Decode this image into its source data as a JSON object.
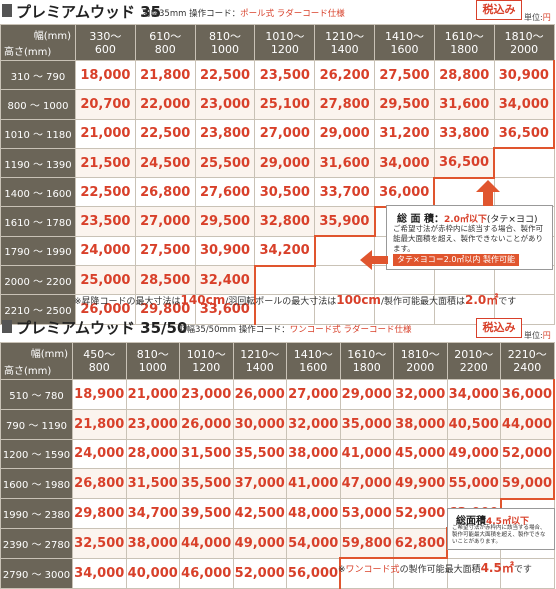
{
  "colors": {
    "accent": "#d8402a",
    "header_bg": "#6b6558",
    "outline": "#e0552e"
  },
  "table1": {
    "title": "プレミアムウッド 35",
    "spec_a": "羽幅35mm 操作コード：",
    "spec_b": "ポール式 ラダーコード仕様",
    "tax": "税込み",
    "unit_a": "単位:",
    "unit_b": "円",
    "corner_w": "幅(mm)",
    "corner_h": "高さ(mm)",
    "columns": [
      [
        "330～",
        "600"
      ],
      [
        "610～",
        "800"
      ],
      [
        "810～",
        "1000"
      ],
      [
        "1010～",
        "1200"
      ],
      [
        "1210～",
        "1400"
      ],
      [
        "1410～",
        "1600"
      ],
      [
        "1610～",
        "1800"
      ],
      [
        "1810～",
        "2000"
      ]
    ],
    "rows": [
      {
        "label": "310 ～ 790",
        "values": [
          "18,000",
          "21,800",
          "22,500",
          "23,500",
          "26,200",
          "27,500",
          "28,800",
          "30,900"
        ]
      },
      {
        "label": "800 ～ 1000",
        "values": [
          "20,700",
          "22,000",
          "23,000",
          "25,100",
          "27,800",
          "29,500",
          "31,600",
          "34,000"
        ]
      },
      {
        "label": "1010 ～ 1180",
        "values": [
          "21,000",
          "22,500",
          "23,800",
          "27,000",
          "29,000",
          "31,200",
          "33,800",
          "36,500"
        ]
      },
      {
        "label": "1190 ～ 1390",
        "values": [
          "21,500",
          "24,500",
          "25,500",
          "29,000",
          "31,600",
          "34,000",
          "36,500",
          ""
        ]
      },
      {
        "label": "1400 ～ 1600",
        "values": [
          "22,500",
          "26,800",
          "27,600",
          "30,500",
          "33,700",
          "36,000",
          "",
          ""
        ]
      },
      {
        "label": "1610 ～ 1780",
        "values": [
          "23,500",
          "27,000",
          "29,500",
          "32,800",
          "35,900",
          "",
          "",
          ""
        ]
      },
      {
        "label": "1790 ～ 1990",
        "values": [
          "24,000",
          "27,500",
          "30,900",
          "34,200",
          "",
          "",
          "",
          ""
        ]
      },
      {
        "label": "2000 ～ 2200",
        "values": [
          "25,000",
          "28,500",
          "32,400",
          "",
          "",
          "",
          "",
          ""
        ]
      },
      {
        "label": "2210 ～ 2500",
        "values": [
          "26,000",
          "29,800",
          "33,600",
          "",
          "",
          "",
          "",
          ""
        ]
      }
    ],
    "callout": {
      "t_a": "総 面 積：",
      "t_b": "2.0㎡以下",
      "t_c": "(タテ×ヨコ)",
      "body": "ご希望寸法が赤枠内に該当する場合、製作可能最大面積を超え、製作できないことがあります。",
      "pill": "タテ×ヨコ＝2.0㎡以内 製作可能"
    },
    "note_a": "※昇降コードの最大寸法は",
    "note_b": "140cm",
    "note_c": "/羽回転ポールの最大寸法は",
    "note_d": "100cm",
    "note_e": "/製作可能最大面積は",
    "note_f": "2.0㎡",
    "note_g": "です"
  },
  "table2": {
    "title": "プレミアムウッド 35/50",
    "spec_a": "羽幅35/50mm 操作コード：",
    "spec_b": "ワンコード式 ラダーコード仕様",
    "tax": "税込み",
    "unit_a": "単位:",
    "unit_b": "円",
    "corner_w": "幅(mm)",
    "corner_h": "高さ(mm)",
    "columns": [
      [
        "450～",
        "800"
      ],
      [
        "810～",
        "1000"
      ],
      [
        "1010～",
        "1200"
      ],
      [
        "1210～",
        "1400"
      ],
      [
        "1410～",
        "1600"
      ],
      [
        "1610～",
        "1800"
      ],
      [
        "1810～",
        "2000"
      ],
      [
        "2010～",
        "2200"
      ],
      [
        "2210～",
        "2400"
      ]
    ],
    "rows": [
      {
        "label": "510 ～ 780",
        "values": [
          "18,900",
          "21,000",
          "23,000",
          "26,000",
          "27,000",
          "29,000",
          "32,000",
          "34,000",
          "36,000"
        ]
      },
      {
        "label": "790 ～ 1190",
        "values": [
          "21,800",
          "23,000",
          "26,000",
          "30,000",
          "32,000",
          "35,000",
          "38,000",
          "40,500",
          "44,000"
        ]
      },
      {
        "label": "1200 ～ 1590",
        "values": [
          "24,000",
          "28,000",
          "31,500",
          "35,500",
          "38,000",
          "41,000",
          "45,000",
          "49,000",
          "52,000"
        ]
      },
      {
        "label": "1600 ～ 1980",
        "values": [
          "26,800",
          "31,500",
          "35,500",
          "37,000",
          "41,000",
          "47,000",
          "49,900",
          "55,000",
          "59,000"
        ]
      },
      {
        "label": "1990 ～ 2380",
        "values": [
          "29,800",
          "34,700",
          "39,500",
          "42,500",
          "48,000",
          "53,000",
          "52,900",
          "63,000",
          ""
        ]
      },
      {
        "label": "2390 ～ 2780",
        "values": [
          "32,500",
          "38,000",
          "44,000",
          "49,000",
          "54,000",
          "59,800",
          "62,800",
          "",
          ""
        ]
      },
      {
        "label": "2790 ～ 3000",
        "values": [
          "34,000",
          "40,000",
          "46,000",
          "52,000",
          "56,000",
          "",
          "",
          "",
          ""
        ]
      }
    ],
    "callout": {
      "t_a": "総面積",
      "t_b": "4.5㎡以下",
      "body": "ご希望寸法が赤枠内に該当する場合、製作可能最大面積を超え、製作できないことがあります。"
    },
    "note_a": "※",
    "note_b": "ワンコード式",
    "note_c": "の製作可能最大面積",
    "note_d": "4.5㎡",
    "note_e": "です"
  }
}
